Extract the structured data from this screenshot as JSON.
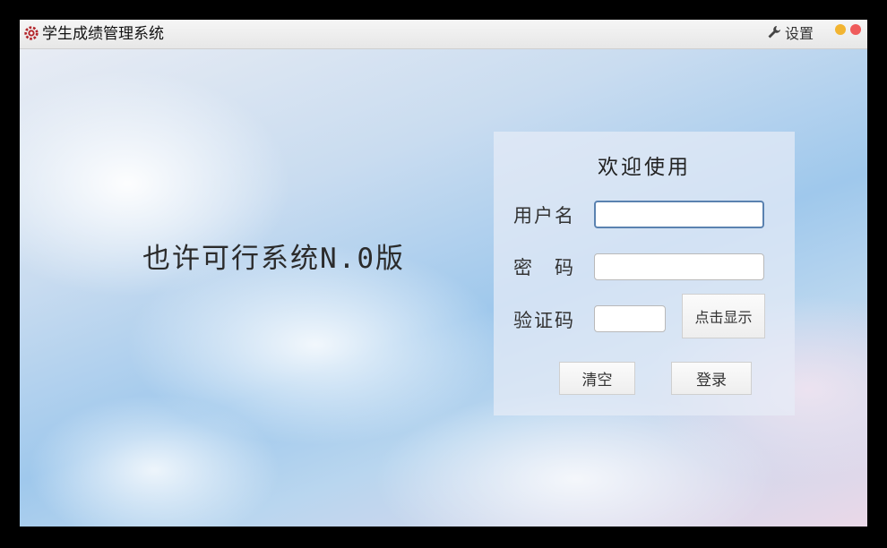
{
  "window": {
    "title": "学生成绩管理系统",
    "app_icon": "gear-logo-icon",
    "settings_label": "设置",
    "settings_icon": "wrench-icon",
    "controls": {
      "minimize_color": "#f2b431",
      "close_color": "#ef5b5b"
    }
  },
  "main": {
    "slogan": "也许可行系统N.0版"
  },
  "login": {
    "welcome": "欢迎使用",
    "username_label": "用户名",
    "username_value": "",
    "password_label": "密　码",
    "password_value": "",
    "captcha_label": "验证码",
    "captcha_value": "",
    "captcha_button": "点击显示",
    "clear_button": "清空",
    "login_button": "登录"
  }
}
